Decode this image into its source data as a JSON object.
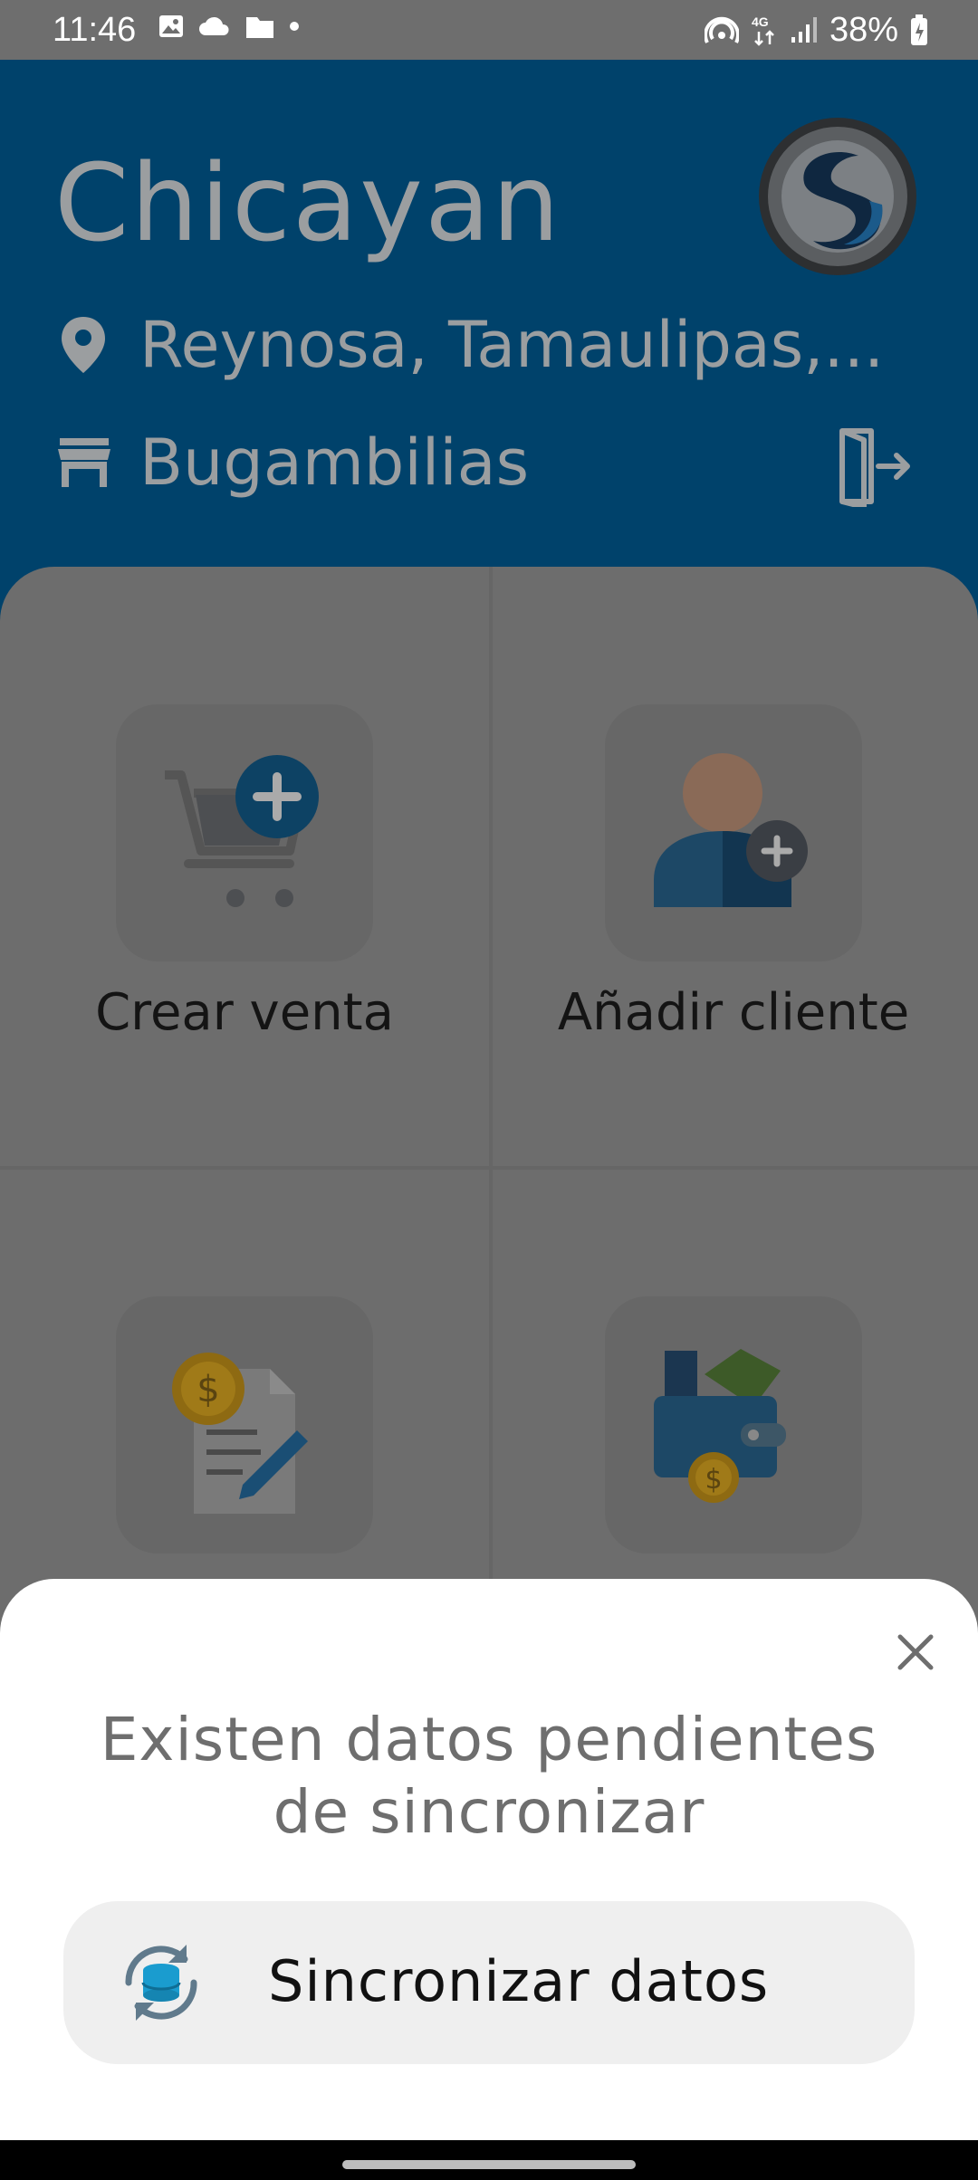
{
  "status_bar": {
    "time": "11:46",
    "battery": "38%",
    "network": "4G",
    "icons": [
      "image-icon",
      "cloud-icon",
      "folder-icon",
      "dot-icon",
      "hotspot-icon",
      "signal-icon",
      "battery-icon"
    ]
  },
  "header": {
    "title": "Chicayan",
    "location": "Reynosa, Tamaulipas,...",
    "store": "Bugambilias",
    "colors": {
      "background": "#00426b",
      "text": "#9b9ea0"
    }
  },
  "menu": {
    "items": [
      {
        "label": "Crear venta",
        "icon": "cart-add-icon"
      },
      {
        "label": "Añadir cliente",
        "icon": "add-user-icon"
      },
      {
        "label": "",
        "icon": "invoice-icon"
      },
      {
        "label": "",
        "icon": "wallet-icon"
      }
    ]
  },
  "sheet": {
    "title_line1": "Existen datos pendientes",
    "title_line2": "de sincronizar",
    "sync_button_label": "Sincronizar datos",
    "colors": {
      "accent": "#1a9ccf"
    }
  }
}
